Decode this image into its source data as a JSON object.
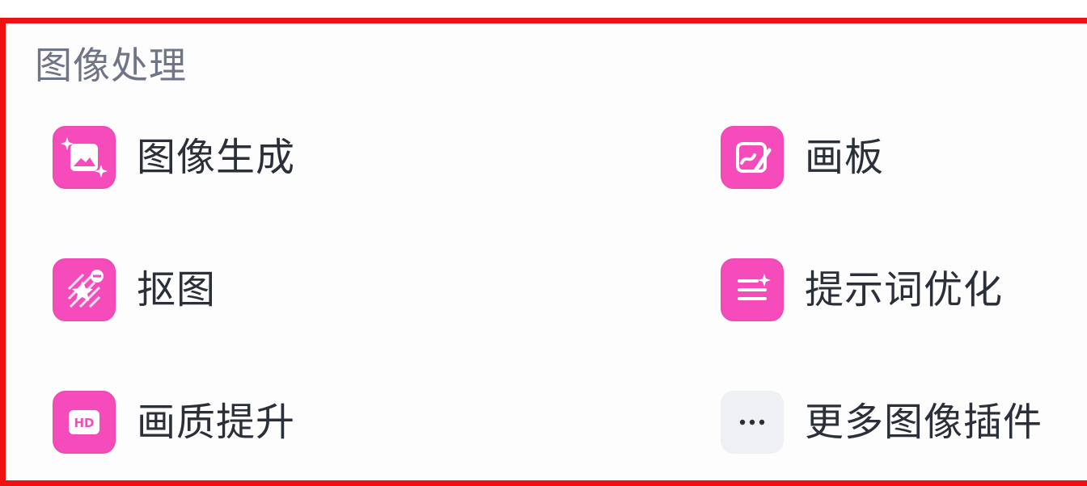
{
  "section": {
    "title": "图像处理"
  },
  "items": [
    {
      "label": "图像生成",
      "icon": "image-sparkle-icon"
    },
    {
      "label": "画板",
      "icon": "drawing-board-icon"
    },
    {
      "label": "抠图",
      "icon": "cutout-star-icon"
    },
    {
      "label": "提示词优化",
      "icon": "prompt-sliders-icon"
    },
    {
      "label": "画质提升",
      "icon": "hd-icon"
    },
    {
      "label": "更多图像插件",
      "icon": "more-dots-icon"
    }
  ],
  "icon_text": {
    "hd": "HD"
  },
  "colors": {
    "accent_pink": "#f54bbb",
    "frame_border": "#ee1111",
    "title_gray": "#6f7586",
    "label_dark": "#2a2f3a"
  }
}
